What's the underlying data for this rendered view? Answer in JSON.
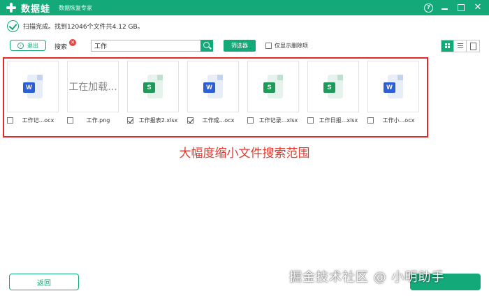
{
  "app": {
    "name": "数据蛙",
    "subtitle": "数据恢复专家"
  },
  "window": {
    "help": "?",
    "close": "✕"
  },
  "status": {
    "text": "扫描完成。找到12046个文件共4.12 GB。"
  },
  "toolbar": {
    "back_label": "退出",
    "back_arrow": "‹",
    "search_label": "搜索",
    "clear_icon": "✕",
    "search_value": "工作",
    "filter_label": "筛选器",
    "deleted_only_label": "仅显示删除项"
  },
  "files": [
    {
      "name": "工作记...ocx",
      "type": "word",
      "checked": false
    },
    {
      "name": "工作.png",
      "type": "loading",
      "loading_text": "工在加载...",
      "checked": false
    },
    {
      "name": "工作报表2.xlsx",
      "type": "excel",
      "checked": true
    },
    {
      "name": "工作成...ocx",
      "type": "word",
      "checked": true
    },
    {
      "name": "工作记录...xlsx",
      "type": "excel",
      "checked": false
    },
    {
      "name": "工作日报...xlsx",
      "type": "excel",
      "checked": false
    },
    {
      "name": "工作小...ocx",
      "type": "word",
      "checked": false
    }
  ],
  "badges": {
    "word": "W",
    "excel": "S"
  },
  "caption": "大幅度缩小文件搜索范围",
  "footer": {
    "back_label": "返回"
  },
  "watermark": "掘金技术社区 @ 小明助手",
  "colors": {
    "accent": "#13a979",
    "highlight": "#e02a2a",
    "caption": "#e03a2f",
    "word": "#2b5fd6",
    "excel": "#1f9a5a"
  }
}
